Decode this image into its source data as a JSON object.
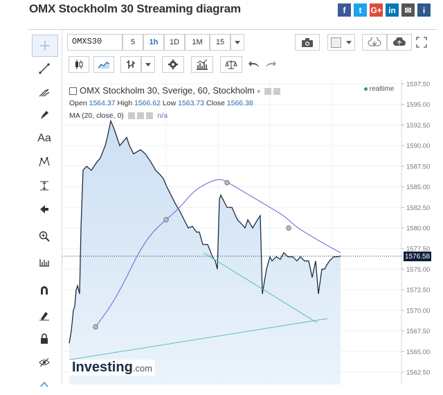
{
  "page": {
    "title": "OMX Stockholm 30 Streaming diagram"
  },
  "social": [
    {
      "name": "facebook-icon",
      "glyph": "f",
      "color": "#3b5998"
    },
    {
      "name": "twitter-icon",
      "glyph": "t",
      "color": "#1da1f2"
    },
    {
      "name": "google-plus-icon",
      "glyph": "G+",
      "color": "#dd4b39"
    },
    {
      "name": "linkedin-icon",
      "glyph": "in",
      "color": "#0077b5"
    },
    {
      "name": "email-icon",
      "glyph": "✉",
      "color": "#555555"
    },
    {
      "name": "info-icon",
      "glyph": "i",
      "color": "#2c5a8c"
    }
  ],
  "toolbar": {
    "symbol": "OMXS30",
    "intervals": [
      "5",
      "1h",
      "1D",
      "1M",
      "15"
    ],
    "active_interval": "1h"
  },
  "legend": {
    "title": "OMX Stockholm 30, Sverige, 60, Stockholm",
    "open_label": "Open",
    "open": "1564.37",
    "high_label": "High",
    "high": "1566.62",
    "low_label": "Low",
    "low": "1563.73",
    "close_label": "Close",
    "close": "1566.38",
    "ma": "MA (20, close, 0)",
    "ma_value": "n/a",
    "realtime": "realtime"
  },
  "price_axis": {
    "ticks": [
      "1597.50",
      "1595.00",
      "1592.50",
      "1590.00",
      "1587.50",
      "1585.00",
      "1582.50",
      "1580.00",
      "1577.50",
      "1575.00",
      "1572.50",
      "1570.00",
      "1567.50",
      "1565.00",
      "1562.50"
    ],
    "last_price": "1576.58"
  },
  "brand": {
    "name": "Investing",
    "suffix": ".com"
  },
  "chart_data": {
    "type": "area",
    "ylim": [
      1562.0,
      1598.0
    ],
    "price_series": [
      [
        0,
        1566.0
      ],
      [
        3,
        1567.5
      ],
      [
        6,
        1570.0
      ],
      [
        8,
        1570.5
      ],
      [
        10,
        1572.5
      ],
      [
        12,
        1573.0
      ],
      [
        15,
        1572.0
      ],
      [
        17,
        1580.0
      ],
      [
        20,
        1587.0
      ],
      [
        25,
        1587.5
      ],
      [
        32,
        1587.0
      ],
      [
        40,
        1588.0
      ],
      [
        45,
        1588.5
      ],
      [
        52,
        1590.0
      ],
      [
        55,
        1591.0
      ],
      [
        60,
        1593.0
      ],
      [
        65,
        1592.0
      ],
      [
        73,
        1590.0
      ],
      [
        78,
        1590.5
      ],
      [
        83,
        1591.0
      ],
      [
        87,
        1590.0
      ],
      [
        93,
        1589.0
      ],
      [
        103,
        1589.5
      ],
      [
        110,
        1589.0
      ],
      [
        118,
        1588.0
      ],
      [
        125,
        1587.0
      ],
      [
        131,
        1586.5
      ],
      [
        136,
        1586.0
      ],
      [
        141,
        1585.0
      ],
      [
        147,
        1584.0
      ],
      [
        153,
        1583.0
      ],
      [
        160,
        1582.0
      ],
      [
        166,
        1581.0
      ],
      [
        172,
        1580.0
      ],
      [
        178,
        1580.2
      ],
      [
        184,
        1579.5
      ],
      [
        188,
        1579.5
      ],
      [
        193,
        1578.0
      ],
      [
        200,
        1578.0
      ],
      [
        207,
        1576.5
      ],
      [
        211,
        1576.0
      ],
      [
        214,
        1575.0
      ],
      [
        217,
        1583.5
      ],
      [
        219,
        1584.0
      ],
      [
        222,
        1583.5
      ],
      [
        228,
        1582.5
      ],
      [
        235,
        1582.5
      ],
      [
        243,
        1581.0
      ],
      [
        249,
        1580.5
      ],
      [
        254,
        1580.0
      ],
      [
        258,
        1581.0
      ],
      [
        265,
        1580.0
      ],
      [
        272,
        1581.0
      ],
      [
        276,
        1581.5
      ],
      [
        279,
        1572.0
      ],
      [
        285,
        1575.0
      ],
      [
        290,
        1576.5
      ],
      [
        293,
        1576.0
      ],
      [
        299,
        1576.5
      ],
      [
        305,
        1576.2
      ],
      [
        310,
        1577.0
      ],
      [
        316,
        1576.5
      ],
      [
        323,
        1576.5
      ],
      [
        329,
        1576.0
      ],
      [
        334,
        1576.5
      ],
      [
        340,
        1576.0
      ],
      [
        346,
        1576.0
      ],
      [
        351,
        1574.0
      ],
      [
        356,
        1576.0
      ],
      [
        360,
        1572.0
      ],
      [
        365,
        1575.0
      ],
      [
        369,
        1575.0
      ],
      [
        372,
        1575.5
      ],
      [
        376,
        1576.0
      ],
      [
        382,
        1576.5
      ],
      [
        387,
        1576.5
      ],
      [
        392,
        1576.6
      ]
    ],
    "ma_series": [
      [
        38,
        1568.0
      ],
      [
        60,
        1570.5
      ],
      [
        80,
        1573.5
      ],
      [
        100,
        1577.0
      ],
      [
        120,
        1579.5
      ],
      [
        140,
        1581.0
      ],
      [
        160,
        1582.5
      ],
      [
        180,
        1584.5
      ],
      [
        200,
        1585.5
      ],
      [
        218,
        1586.0
      ],
      [
        230,
        1585.5
      ],
      [
        250,
        1584.5
      ],
      [
        270,
        1583.5
      ],
      [
        290,
        1582.5
      ],
      [
        310,
        1581.5
      ],
      [
        330,
        1580.0
      ],
      [
        350,
        1579.0
      ],
      [
        370,
        1578.0
      ],
      [
        392,
        1577.0
      ]
    ],
    "ma_points": [
      [
        38,
        1568.0
      ],
      [
        140,
        1581.0
      ],
      [
        228,
        1585.5
      ],
      [
        317,
        1580.0
      ]
    ],
    "trend_lines": [
      [
        [
          0,
          1564.0
        ],
        [
          373,
          1569.0
        ]
      ],
      [
        [
          194,
          1577.0
        ],
        [
          358,
          1568.5
        ]
      ]
    ]
  }
}
